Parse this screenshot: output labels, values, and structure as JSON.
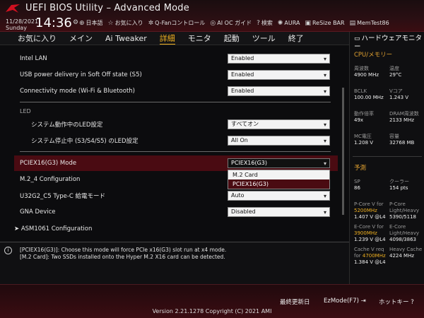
{
  "header": {
    "title": "UEFI BIOS Utility – Advanced Mode",
    "date": "11/28/2021",
    "day": "Sunday",
    "time": "14:36",
    "tools": [
      {
        "icon": "globe-icon",
        "glyph": "⊕",
        "label": "日本語"
      },
      {
        "icon": "star-icon",
        "glyph": "☆",
        "label": "お気に入り"
      },
      {
        "icon": "fan-icon",
        "glyph": "✲",
        "label": "Q-Fanコントロール"
      },
      {
        "icon": "ai-oc-icon",
        "glyph": "◎",
        "label": "AI OC ガイド"
      },
      {
        "icon": "search-icon",
        "glyph": "?",
        "label": "検索"
      },
      {
        "icon": "aura-icon",
        "glyph": "✺",
        "label": "AURA"
      },
      {
        "icon": "resize-bar-icon",
        "glyph": "▣",
        "label": "ReSize BAR"
      },
      {
        "icon": "memtest-icon",
        "glyph": "▤",
        "label": "MemTest86"
      }
    ]
  },
  "menu": {
    "items": [
      "お気に入り",
      "メイン",
      "Ai Tweaker",
      "詳細",
      "モニタ",
      "起動",
      "ツール",
      "終了"
    ],
    "active_index": 3
  },
  "settings": {
    "intel_lan": {
      "label": "Intel LAN",
      "value": "Enabled"
    },
    "usb_power": {
      "label": "USB power delivery in Soft Off state (S5)",
      "value": "Enabled"
    },
    "connectivity": {
      "label": "Connectivity mode (Wi-Fi & Bluetooth)",
      "value": "Enabled"
    },
    "led_section": "LED",
    "led_working": {
      "label": "システム動作中のLED設定",
      "value": "すべてオン"
    },
    "led_sleep": {
      "label": "システム停止中 (S3/S4/S5) のLED設定",
      "value": "All On"
    },
    "pciex16": {
      "label": "PCIEX16(G3) Mode",
      "value": "PCIEX16(G3)"
    },
    "m2_4": {
      "label": "M.2_4 Configuration"
    },
    "u32g2": {
      "label": "U32G2_C5 Type-C 給電モード",
      "value": "Auto"
    },
    "gna": {
      "label": "GNA Device",
      "value": "Disabled"
    },
    "asm1061": {
      "label": "ASM1061 Configuration"
    }
  },
  "dropdown": {
    "options": [
      "M.2 Card",
      "PCIEX16(G3)"
    ],
    "selected_index": 1
  },
  "help": {
    "line1": "[PCIEX16(G3)]: Choose this mode will force PCIe x16(G3) slot run at x4 mode.",
    "line2": "[M.2 Card]: Two SSDs installed onto the Hyper M.2 X16 card can be detected."
  },
  "monitor": {
    "title": "ハードウェアモニター",
    "cpu_section": "CPU/メモリー",
    "cpu": [
      {
        "k": "周波数",
        "v": "4900 MHz"
      },
      {
        "k": "温度",
        "v": "29°C"
      },
      {
        "k": "BCLK",
        "v": "100.00 MHz"
      },
      {
        "k": "Vコア",
        "v": "1.243 V"
      },
      {
        "k": "動作倍率",
        "v": "49x"
      },
      {
        "k": "DRAM周波数",
        "v": "2133 MHz"
      },
      {
        "k": "MC電圧",
        "v": "1.208 V"
      },
      {
        "k": "容量",
        "v": "32768 MB"
      }
    ],
    "predict_section": "予測",
    "predict": {
      "sp_k": "SP",
      "sp_v": "86",
      "cooler_k": "クーラー",
      "cooler_v": "154 pts",
      "pcore_k": "P-Core V for",
      "pcore_hl": "5200MHz",
      "pcore_v": "1.407 V @L4",
      "pcore_lh_k": "P-Core",
      "pcore_lh_k2": "Light/Heavy",
      "pcore_lh_v": "5390/5118",
      "ecore_k": "E-Core V for",
      "ecore_hl": "3900MHz",
      "ecore_v": "1.239 V @L4",
      "ecore_lh_k": "E-Core",
      "ecore_lh_k2": "Light/Heavy",
      "ecore_lh_v": "4098/3863",
      "cache_k": "Cache V req",
      "cache_k2": "for",
      "cache_hl": "4700MHz",
      "cache_v": "1.384 V @L4",
      "heavy_k": "Heavy Cache",
      "heavy_v": "4224 MHz"
    }
  },
  "footer": {
    "last_change": "最終更新日",
    "ezmode": "EzMode(F7)",
    "hotkey": "ホットキー",
    "version": "Version 2.21.1278 Copyright (C) 2021 AMI"
  }
}
